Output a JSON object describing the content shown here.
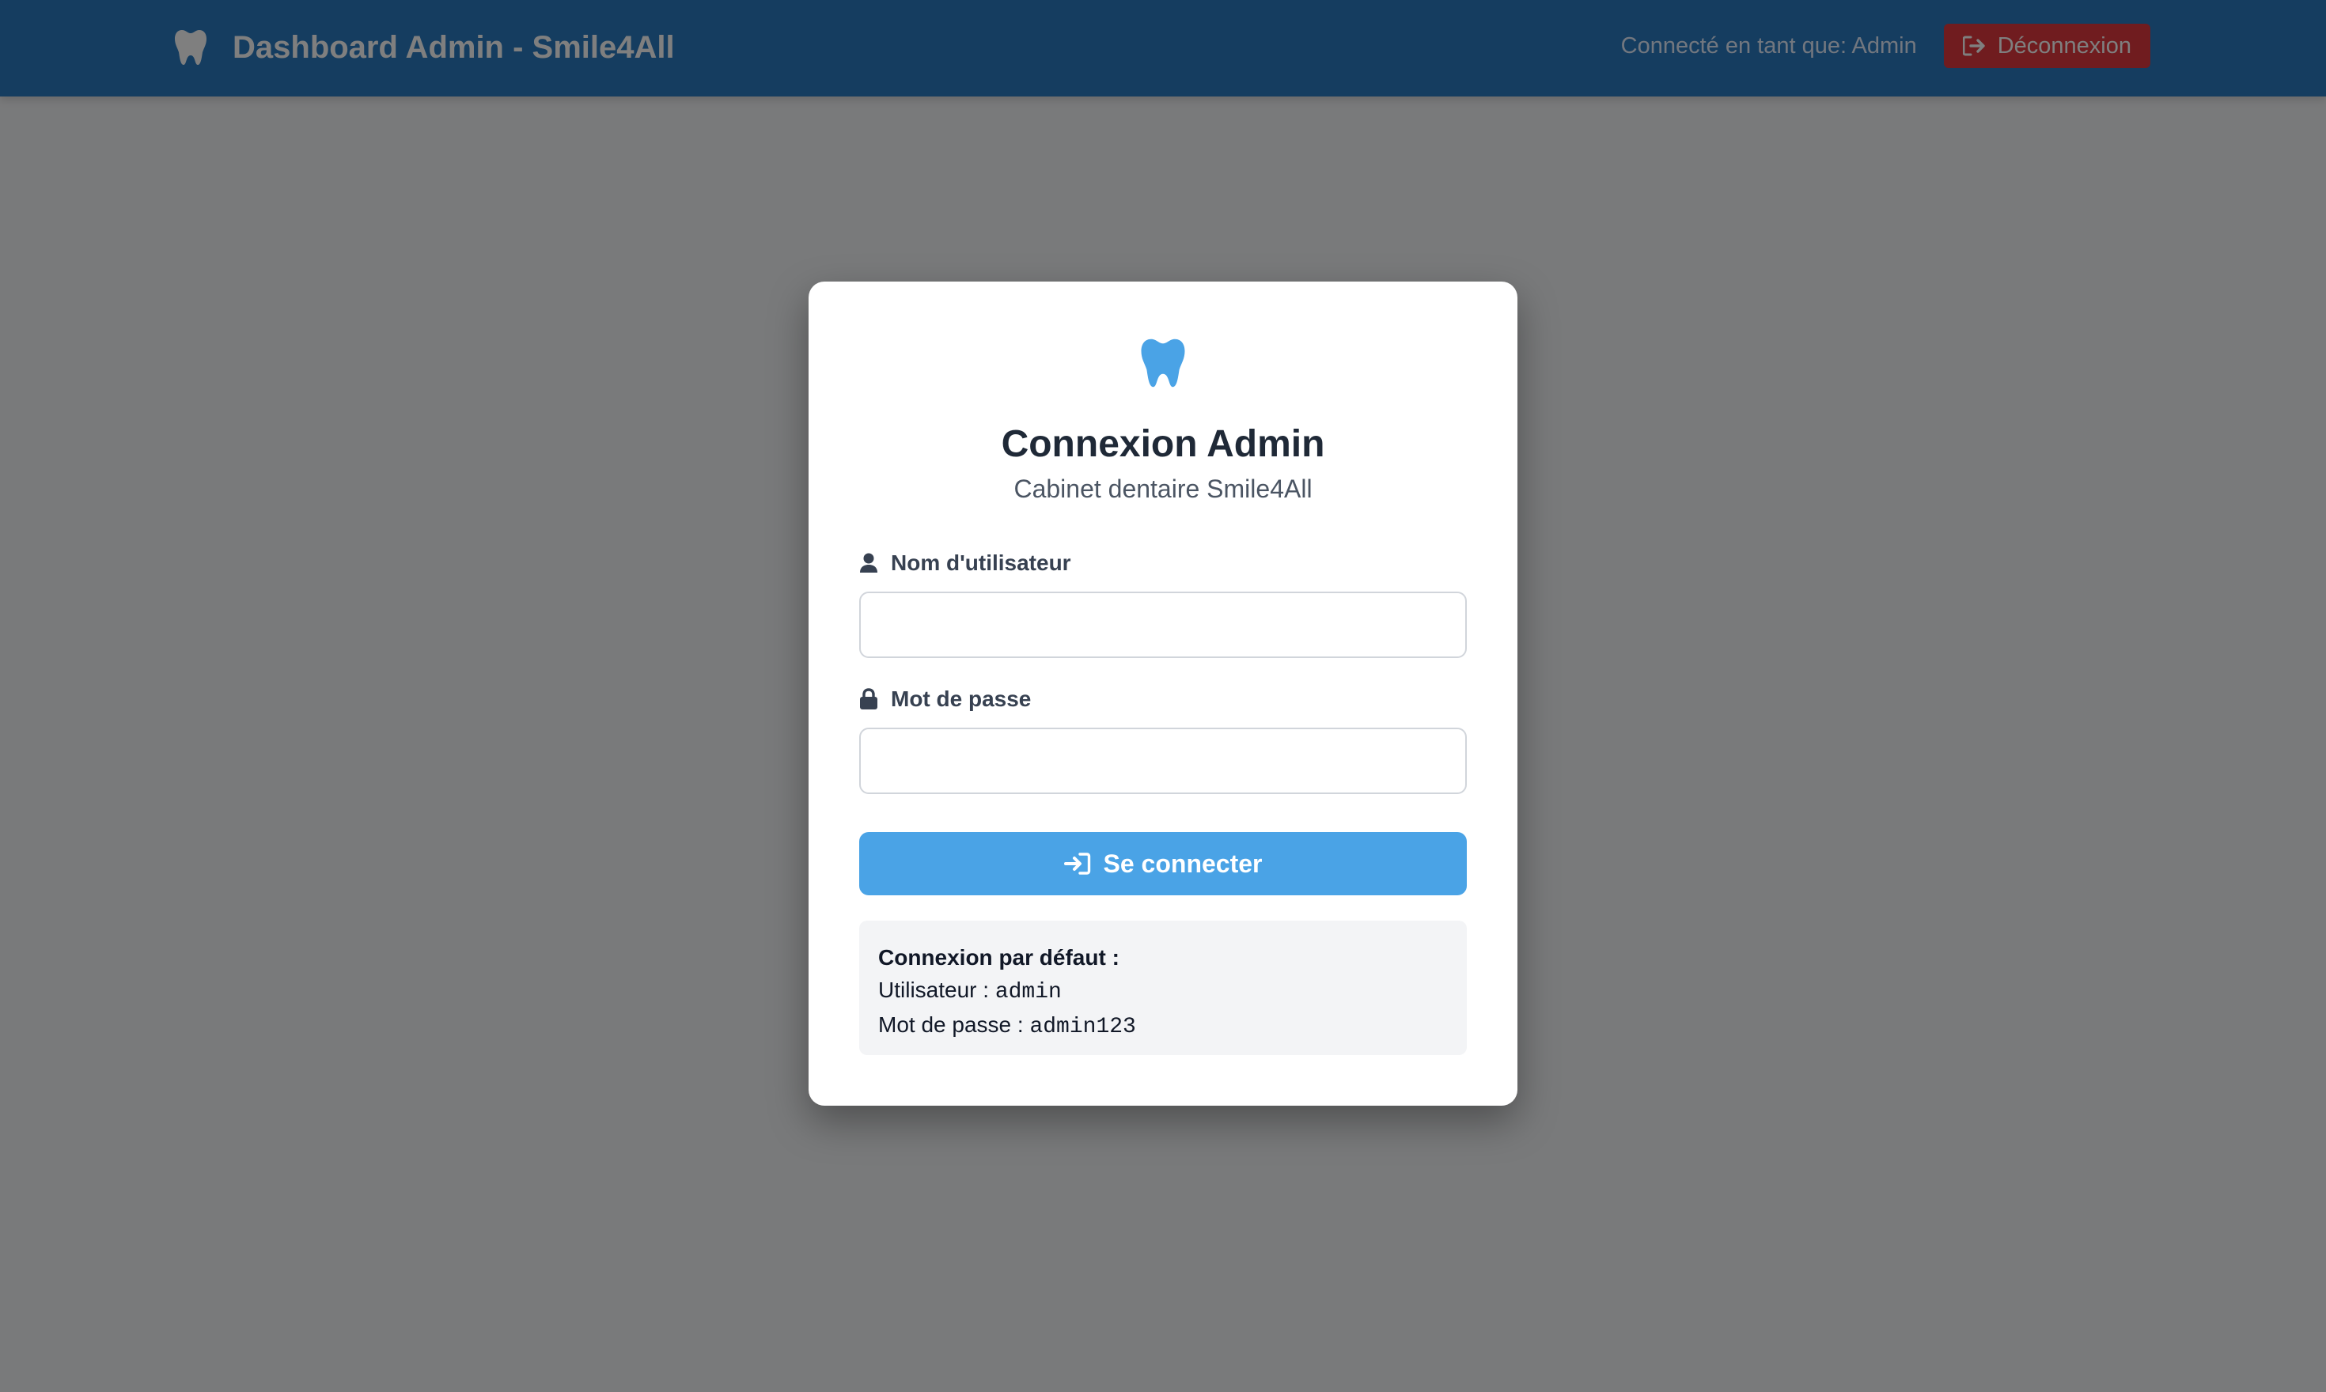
{
  "navbar": {
    "title": "Dashboard Admin - Smile4All",
    "brand_icon": "tooth-icon",
    "user_text": "Connecté en tant que: Admin",
    "logout_label": "Déconnexion",
    "logout_icon": "logout-icon"
  },
  "login": {
    "icon": "tooth-icon",
    "title": "Connexion Admin",
    "subtitle": "Cabinet dentaire Smile4All",
    "username_label": "Nom d'utilisateur",
    "username_icon": "user-icon",
    "username_value": "",
    "password_label": "Mot de passe",
    "password_icon": "lock-icon",
    "password_value": "",
    "submit_label": "Se connecter",
    "submit_icon": "sign-in-icon"
  },
  "defaults": {
    "heading": "Connexion par défaut :",
    "user_prefix": "Utilisateur : ",
    "user_value": "admin",
    "pass_prefix": "Mot de passe : ",
    "pass_value": "admin123"
  },
  "colors": {
    "navbar": "#2b7bc0",
    "logout": "#e0383e",
    "primary": "#4aa3e6",
    "overlay": "rgba(0,0,0,0.5)"
  }
}
